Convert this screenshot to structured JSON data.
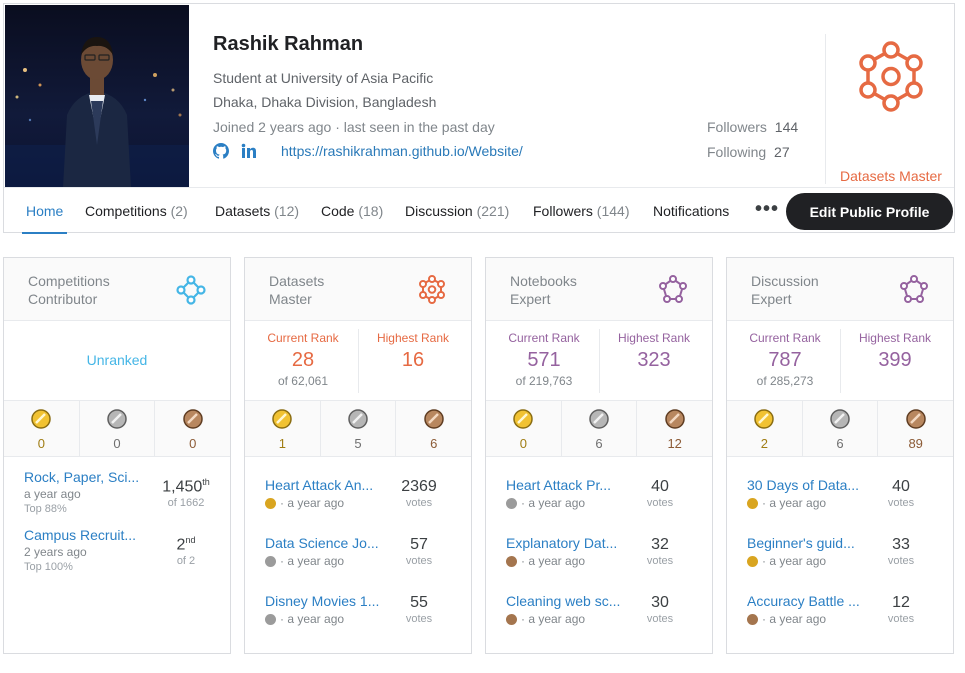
{
  "profile": {
    "name": "Rashik Rahman",
    "occupation": "Student at University of Asia Pacific",
    "location": "Dhaka, Dhaka Division, Bangladesh",
    "joined": "Joined 2 years ago · last seen in the past day",
    "website": "https://rashikrahman.github.io/Website/",
    "followers_label": "Followers",
    "followers_count": "144",
    "following_label": "Following",
    "following_count": "27",
    "tier_label": "Datasets Master",
    "tier_color": "#e66a43"
  },
  "tabs": [
    {
      "label": "Home",
      "count": ""
    },
    {
      "label": "Competitions",
      "count": "(2)"
    },
    {
      "label": "Datasets",
      "count": "(12)"
    },
    {
      "label": "Code",
      "count": "(18)"
    },
    {
      "label": "Discussion",
      "count": "(221)"
    },
    {
      "label": "Followers",
      "count": "(144)"
    },
    {
      "label": "Notifications",
      "count": ""
    }
  ],
  "more_label": "•••",
  "edit_profile_label": "Edit Public Profile",
  "cards": [
    {
      "title_line1": "Competitions",
      "title_line2": "Contributor",
      "color": "#45b6e6",
      "unranked": "Unranked",
      "medals": {
        "gold": "0",
        "silver": "0",
        "bronze": "0"
      },
      "items": [
        {
          "title": "Rock, Paper, Sci...",
          "time": "a year ago",
          "top": "Top 88%",
          "rank": "1,450",
          "suffix": "th",
          "of": "of 1662"
        },
        {
          "title": "Campus Recruit...",
          "time": "2 years ago",
          "top": "Top 100%",
          "rank": "2",
          "suffix": "nd",
          "of": "of 2"
        }
      ]
    },
    {
      "title_line1": "Datasets",
      "title_line2": "Master",
      "color": "#e66a43",
      "current_rank_label": "Current Rank",
      "current_rank": "28",
      "current_of": "of 62,061",
      "highest_rank_label": "Highest Rank",
      "highest_rank": "16",
      "medals": {
        "gold": "1",
        "silver": "5",
        "bronze": "6"
      },
      "items": [
        {
          "title": "Heart Attack An...",
          "medal": "gold",
          "time": "· a year ago",
          "votes": "2369",
          "unit": "votes"
        },
        {
          "title": "Data Science Jo...",
          "medal": "silver",
          "time": "· a year ago",
          "votes": "57",
          "unit": "votes"
        },
        {
          "title": "Disney Movies 1...",
          "medal": "silver",
          "time": "· a year ago",
          "votes": "55",
          "unit": "votes"
        }
      ]
    },
    {
      "title_line1": "Notebooks",
      "title_line2": "Expert",
      "color": "#95629f",
      "current_rank_label": "Current Rank",
      "current_rank": "571",
      "current_of": "of 219,763",
      "highest_rank_label": "Highest Rank",
      "highest_rank": "323",
      "medals": {
        "gold": "0",
        "silver": "6",
        "bronze": "12"
      },
      "items": [
        {
          "title": "Heart Attack Pr...",
          "medal": "silver",
          "time": "· a year ago",
          "votes": "40",
          "unit": "votes"
        },
        {
          "title": "Explanatory Dat...",
          "medal": "bronze",
          "time": "· a year ago",
          "votes": "32",
          "unit": "votes"
        },
        {
          "title": "Cleaning web sc...",
          "medal": "bronze",
          "time": "· a year ago",
          "votes": "30",
          "unit": "votes"
        }
      ]
    },
    {
      "title_line1": "Discussion",
      "title_line2": "Expert",
      "color": "#95629f",
      "current_rank_label": "Current Rank",
      "current_rank": "787",
      "current_of": "of 285,273",
      "highest_rank_label": "Highest Rank",
      "highest_rank": "399",
      "medals": {
        "gold": "2",
        "silver": "6",
        "bronze": "89"
      },
      "items": [
        {
          "title": "30 Days of Data...",
          "medal": "gold",
          "time": "· a year ago",
          "votes": "40",
          "unit": "votes"
        },
        {
          "title": "Beginner's guid...",
          "medal": "gold",
          "time": "· a year ago",
          "votes": "33",
          "unit": "votes"
        },
        {
          "title": "Accuracy Battle ...",
          "medal": "bronze",
          "time": "· a year ago",
          "votes": "12",
          "unit": "votes"
        }
      ]
    }
  ]
}
